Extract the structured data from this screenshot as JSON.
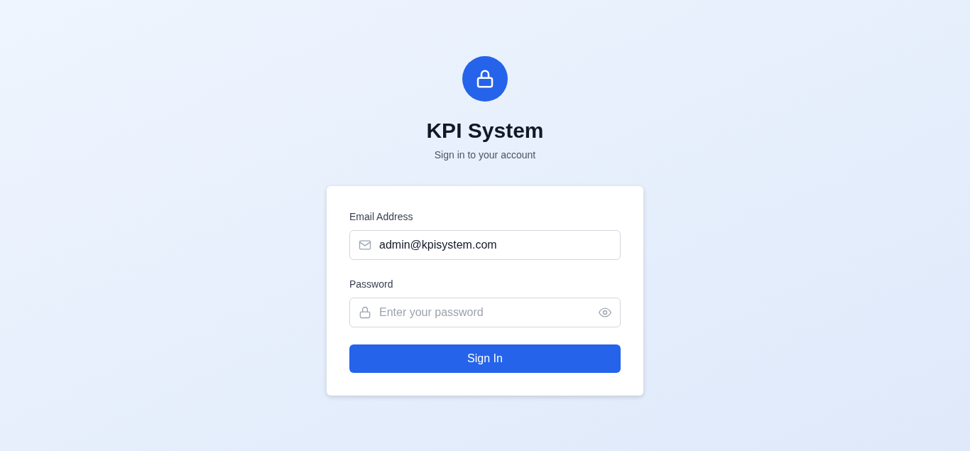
{
  "header": {
    "title": "KPI System",
    "subtitle": "Sign in to your account"
  },
  "form": {
    "fields": [
      {
        "kind": "email",
        "label": "Email Address",
        "value": "admin@kpisystem.com"
      },
      {
        "kind": "password",
        "label": "Password",
        "placeholder": "Enter your password"
      }
    ],
    "submit": "Sign In"
  }
}
